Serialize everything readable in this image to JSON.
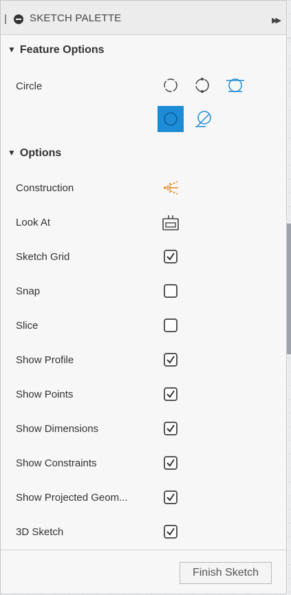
{
  "palette": {
    "title": "SKETCH PALETTE",
    "finish_label": "Finish Sketch"
  },
  "feature_options": {
    "header": "Feature Options",
    "circle_label": "Circle",
    "circle_tools": [
      {
        "icon": "center-diameter-circle-icon",
        "active": false
      },
      {
        "icon": "two-point-circle-icon",
        "active": false
      },
      {
        "icon": "three-point-circle-icon",
        "active": false
      },
      {
        "icon": "2-tangent-circle-icon",
        "active": true
      },
      {
        "icon": "3-tangent-circle-icon",
        "active": false
      }
    ]
  },
  "options": {
    "header": "Options",
    "construction_label": "Construction",
    "look_at_label": "Look At",
    "checkboxes": [
      {
        "label": "Sketch Grid",
        "checked": true
      },
      {
        "label": "Snap",
        "checked": false
      },
      {
        "label": "Slice",
        "checked": false
      },
      {
        "label": "Show Profile",
        "checked": true
      },
      {
        "label": "Show Points",
        "checked": true
      },
      {
        "label": "Show Dimensions",
        "checked": true
      },
      {
        "label": "Show Constraints",
        "checked": true
      },
      {
        "label": "Show Projected Geom...",
        "checked": true
      },
      {
        "label": "3D Sketch",
        "checked": true
      }
    ]
  },
  "colors": {
    "accent": "#1d8bd6",
    "construction": "#e08a1e"
  }
}
